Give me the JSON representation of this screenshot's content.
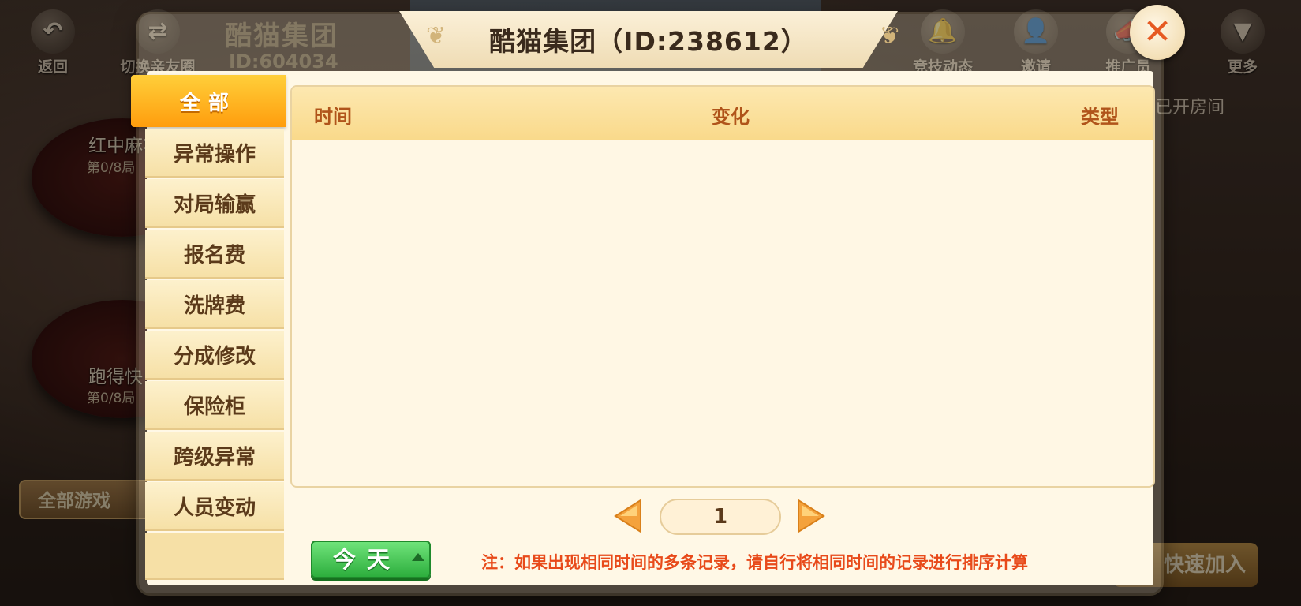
{
  "background": {
    "back_label": "返回",
    "switch_label": "切换亲友圈",
    "club_name": "酷猫集团",
    "club_id": "ID:604034",
    "competition_label": "竞技动态",
    "invite_label": "邀请",
    "promote_label": "推广员",
    "more_label": "更多",
    "hide_opened_rooms": "隐藏已开房间",
    "table1_title": "红中麻将",
    "table1_sub": "第0/8局",
    "table2_title": "跑得快",
    "table2_sub": "第0/8局",
    "all_games_label": "全部游戏",
    "quick_join_label": "快速加入"
  },
  "dialog": {
    "title": "酷猫集团（ID:238612）",
    "close_icon": "close-icon",
    "tabs": [
      {
        "label": "全部",
        "active": true
      },
      {
        "label": "异常操作",
        "active": false
      },
      {
        "label": "对局输赢",
        "active": false
      },
      {
        "label": "报名费",
        "active": false
      },
      {
        "label": "洗牌费",
        "active": false
      },
      {
        "label": "分成修改",
        "active": false
      },
      {
        "label": "保险柜",
        "active": false
      },
      {
        "label": "跨级异常",
        "active": false
      },
      {
        "label": "人员变动",
        "active": false
      }
    ],
    "table": {
      "columns": [
        "时间",
        "变化",
        "类型"
      ],
      "rows": []
    },
    "pager": {
      "current_page": "1",
      "prev_icon": "arrow-left-icon",
      "next_icon": "arrow-right-icon"
    },
    "date_filter": "今天",
    "note": "注：如果出现相同时间的多条记录，请自行将相同时间的记录进行排序计算"
  },
  "colors": {
    "active_tab": "#ff9d0d",
    "header_bg": "#f9d98a",
    "header_text": "#b0541a",
    "note_text": "#e84a1a",
    "today_button": "#2dae3d"
  }
}
